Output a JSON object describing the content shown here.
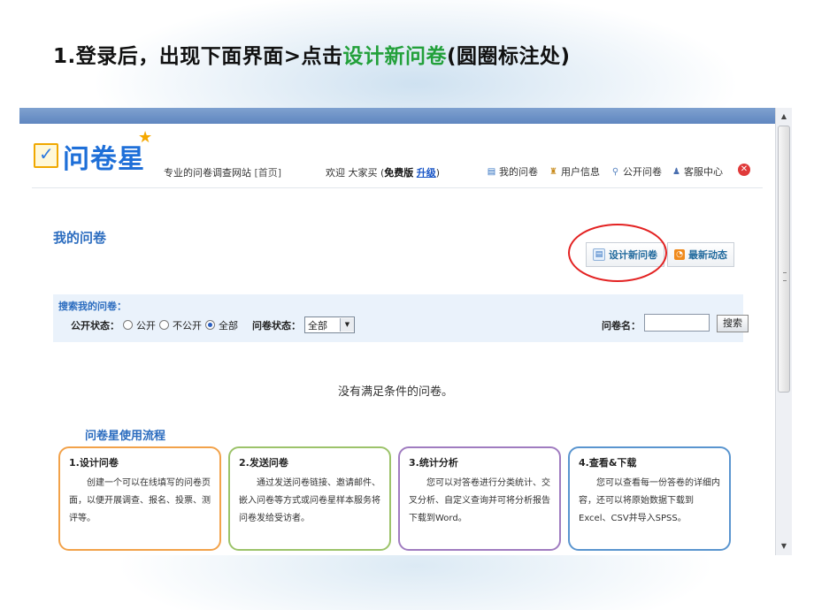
{
  "slide": {
    "title_prefix": "1.登录后，出现下面界面>点击",
    "title_highlight": "设计新问卷",
    "title_suffix": "(圆圈标注处)"
  },
  "header": {
    "logo_text": "问卷星",
    "tagline": "专业的问卷调查网站",
    "home_link": "[首页]",
    "welcome": "欢迎 大家买 (",
    "plan": "免费版",
    "upgrade": "升级",
    "welcome_end": ")",
    "nav": [
      {
        "icon": "list-icon",
        "label": "我的问卷"
      },
      {
        "icon": "user-icon",
        "label": "用户信息"
      },
      {
        "icon": "search-icon",
        "label": "公开问卷"
      },
      {
        "icon": "support-icon",
        "label": "客服中心"
      }
    ]
  },
  "main": {
    "page_title": "我的问卷",
    "design_button": "设计新问卷",
    "news_button": "最新动态",
    "search": {
      "title": "搜索我的问卷：",
      "public_label": "公开状态：",
      "options": [
        "公开",
        "不公开",
        "全部"
      ],
      "selected_option": "全部",
      "status_label": "问卷状态：",
      "status_value": "全部",
      "name_label": "问卷名：",
      "name_value": "",
      "search_button": "搜索"
    },
    "empty_message": "没有满足条件的问卷。",
    "flow": {
      "title": "问卷星使用流程",
      "steps": [
        {
          "title": "1.设计问卷",
          "desc": "创建一个可以在线填写的问卷页面，以便开展调查、报名、投票、测评等。"
        },
        {
          "title": "2.发送问卷",
          "desc": "通过发送问卷链接、邀请邮件、嵌入问卷等方式或问卷星样本服务将问卷发给受访者。"
        },
        {
          "title": "3.统计分析",
          "desc": "您可以对答卷进行分类统计、交叉分析、自定义查询并可将分析报告下载到Word。"
        },
        {
          "title": "4.查看&下载",
          "desc": "您可以查看每一份答卷的详细内容，还可以将原始数据下载到Excel、CSV并导入SPSS。"
        }
      ]
    }
  },
  "colors": {
    "highlight": "#22a03a",
    "link_blue": "#2b6cbf",
    "annotation_circle": "#e32222"
  }
}
